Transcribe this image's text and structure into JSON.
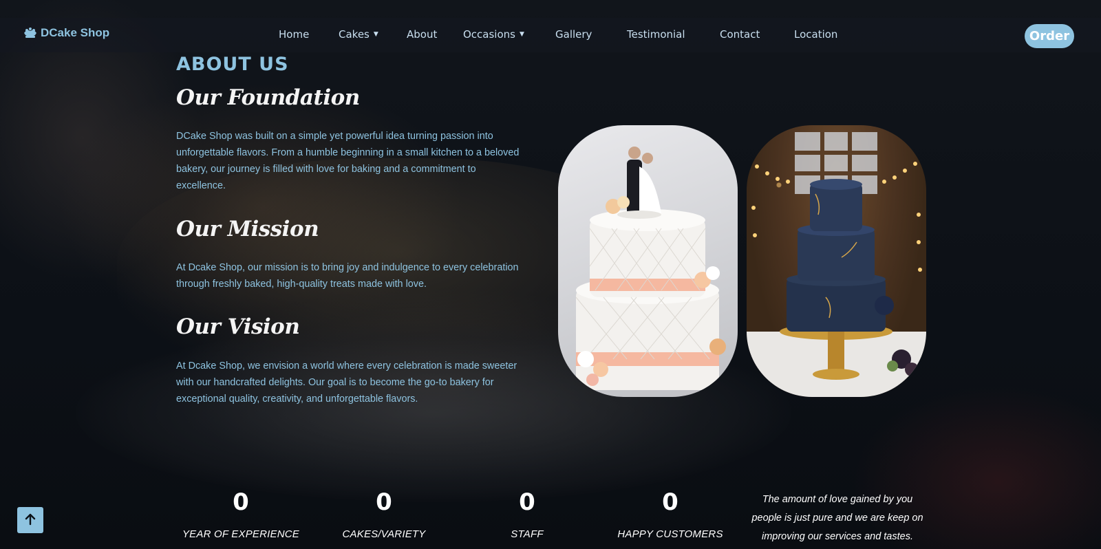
{
  "brand": {
    "name": "DCake Shop"
  },
  "nav": {
    "items": [
      {
        "label": "Home",
        "dropdown": false
      },
      {
        "label": "Cakes",
        "dropdown": true
      },
      {
        "label": "About",
        "dropdown": false
      },
      {
        "label": "Occasions",
        "dropdown": true
      },
      {
        "label": "Gallery",
        "dropdown": false
      },
      {
        "label": "Testimonial",
        "dropdown": false
      },
      {
        "label": "Contact",
        "dropdown": false
      },
      {
        "label": "Location",
        "dropdown": false
      }
    ],
    "order_label": "Order"
  },
  "about": {
    "heading": "ABOUT US",
    "foundation_title": "Our Foundation",
    "foundation_text": "DCake Shop was built on a simple yet powerful idea turning passion into unforgettable flavors. From a humble beginning in a small kitchen to a beloved bakery, our journey is filled with love for baking and a commitment to excellence.",
    "mission_title": "Our Mission",
    "mission_text": "At Dcake Shop, our mission is to bring joy and indulgence to every celebration through freshly baked, high-quality treats made with love.",
    "vision_title": "Our Vision",
    "vision_text": "At Dcake Shop, we envision a world where every celebration is made sweeter with our handcrafted delights. Our goal is to become the go-to bakery for exceptional quality, creativity, and unforgettable flavors."
  },
  "stats": [
    {
      "value": "0",
      "label": "YEAR OF EXPERIENCE"
    },
    {
      "value": "0",
      "label": "CAKES/VARIETY"
    },
    {
      "value": "0",
      "label": "STAFF"
    },
    {
      "value": "0",
      "label": "HAPPY CUSTOMERS"
    }
  ],
  "quote": "The amount of love gained by you people is just pure and we are keep on improving our services and tastes.",
  "colors": {
    "accent": "#8ec3e0",
    "background": "#0a0d12",
    "text_light": "#ffffff"
  },
  "icons": {
    "logo": "cake-logo-icon",
    "back_to_top": "arrow-up-icon",
    "dropdown": "caret-down-icon"
  }
}
